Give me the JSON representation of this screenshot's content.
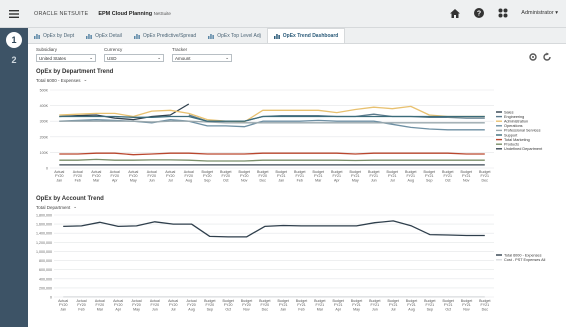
{
  "header": {
    "logo": "ORACLE NETSUITE",
    "app_title": "EPM Cloud Planning",
    "app_subtitle": "NetSuite",
    "user": "Administrator"
  },
  "sidebar": {
    "steps": [
      "1",
      "2"
    ]
  },
  "tabs": [
    {
      "label": "OpEx by Dept",
      "icon": "chart-icon"
    },
    {
      "label": "OpEx Detail",
      "icon": "chart-icon"
    },
    {
      "label": "OpEx Predictive/Spread",
      "icon": "chart-icon"
    },
    {
      "label": "OpEx Top Level Adj",
      "icon": "chart-icon"
    },
    {
      "label": "OpEx Trend Dashboard",
      "icon": "chart-icon",
      "active": true
    }
  ],
  "pov": {
    "subsidiary": {
      "label": "Subsidiary",
      "value": "United States"
    },
    "currency": {
      "label": "Currency",
      "value": "USD"
    },
    "tracker": {
      "label": "Tracker",
      "value": "Amount"
    }
  },
  "chart_data": [
    {
      "type": "line",
      "title": "OpEx by Department Trend",
      "selector": "Total 6000 - Expenses",
      "ylim": [
        0,
        500000
      ],
      "yticks": [
        "0",
        "100K",
        "200K",
        "300K",
        "400K",
        "500K"
      ],
      "x": [
        "Actual FY20 Jan",
        "Actual FY20 Feb",
        "Actual FY20 Mar",
        "Actual FY20 Apr",
        "Actual FY20 May",
        "Actual FY20 Jun",
        "Actual FY20 Jul",
        "Actual FY20 Aug",
        "Budget FY20 Sep",
        "Budget FY20 Oct",
        "Budget FY20 Nov",
        "Budget FY20 Dec",
        "Budget FY21 Jan",
        "Budget FY21 Feb",
        "Budget FY21 Mar",
        "Budget FY21 Apr",
        "Budget FY21 May",
        "Budget FY21 Jun",
        "Budget FY21 Jul",
        "Budget FY21 Aug",
        "Budget FY21 Sep",
        "Budget FY21 Oct",
        "Budget FY21 Nov",
        "Budget FY21 Dec"
      ],
      "series": [
        {
          "name": "Sales",
          "color": "#2f3f4c",
          "values": [
            330000,
            335000,
            340000,
            320000,
            310000,
            330000,
            340000,
            410000,
            null,
            null,
            null,
            null,
            null,
            null,
            null,
            null,
            null,
            null,
            null,
            null,
            null,
            null,
            null,
            null
          ]
        },
        {
          "name": "Engineering",
          "color": "#5b7a8c",
          "values": [
            null,
            null,
            null,
            null,
            null,
            null,
            null,
            340000,
            300000,
            300000,
            300000,
            330000,
            335000,
            335000,
            335000,
            330000,
            330000,
            345000,
            330000,
            330000,
            325000,
            325000,
            320000,
            320000
          ]
        },
        {
          "name": "Administration",
          "color": "#e8c170",
          "values": [
            340000,
            345000,
            350000,
            350000,
            330000,
            365000,
            370000,
            350000,
            310000,
            300000,
            295000,
            370000,
            370000,
            370000,
            370000,
            355000,
            375000,
            390000,
            380000,
            395000,
            340000,
            330000,
            330000,
            330000
          ]
        },
        {
          "name": "Operations",
          "color": "#6d8fa3",
          "values": [
            300000,
            305000,
            310000,
            305000,
            300000,
            290000,
            310000,
            300000,
            270000,
            270000,
            265000,
            300000,
            300000,
            300000,
            305000,
            300000,
            300000,
            300000,
            280000,
            260000,
            250000,
            245000,
            245000,
            245000
          ]
        },
        {
          "name": "Professional Services",
          "color": "#9aa8ad",
          "values": [
            300000,
            300000,
            300000,
            300000,
            300000,
            295000,
            300000,
            300000,
            295000,
            290000,
            290000,
            290000,
            290000,
            290000,
            290000,
            290000,
            290000,
            290000,
            290000,
            290000,
            290000,
            290000,
            290000,
            290000
          ]
        },
        {
          "name": "Support",
          "color": "#3b6b7a",
          "values": [
            330000,
            330000,
            330000,
            330000,
            325000,
            325000,
            330000,
            330000,
            300000,
            300000,
            300000,
            330000,
            330000,
            330000,
            330000,
            330000,
            330000,
            330000,
            330000,
            330000,
            330000,
            330000,
            330000,
            330000
          ]
        },
        {
          "name": "Total Marketing",
          "color": "#b9472f",
          "values": [
            90000,
            90000,
            95000,
            95000,
            85000,
            90000,
            95000,
            95000,
            90000,
            90000,
            90000,
            95000,
            95000,
            95000,
            95000,
            95000,
            90000,
            95000,
            95000,
            95000,
            95000,
            95000,
            90000,
            90000
          ]
        },
        {
          "name": "Products",
          "color": "#7a8f6a",
          "values": [
            50000,
            50000,
            55000,
            50000,
            50000,
            52000,
            52000,
            50000,
            45000,
            45000,
            45000,
            50000,
            50000,
            50000,
            50000,
            50000,
            48000,
            50000,
            50000,
            50000,
            50000,
            50000,
            50000,
            50000
          ]
        },
        {
          "name": "Undefined Department",
          "color": "#3d4a55",
          "values": [
            20000,
            20000,
            20000,
            20000,
            20000,
            20000,
            20000,
            20000,
            20000,
            20000,
            20000,
            20000,
            20000,
            20000,
            20000,
            20000,
            20000,
            20000,
            20000,
            20000,
            20000,
            20000,
            20000,
            20000
          ]
        }
      ]
    },
    {
      "type": "line",
      "title": "OpEx by Account Trend",
      "selector": "Total Department",
      "ylim": [
        0,
        1800000
      ],
      "yticks": [
        "0",
        "200,000",
        "400,000",
        "600,000",
        "800,000",
        "1,000,000",
        "1,200,000",
        "1,400,000",
        "1,600,000",
        "1,800,000"
      ],
      "x": [
        "Actual FY20 Jan",
        "Actual FY20 Feb",
        "Actual FY20 Mar",
        "Actual FY20 Apr",
        "Actual FY20 May",
        "Actual FY20 Jun",
        "Actual FY20 Jul",
        "Actual FY20 Aug",
        "Budget FY20 Sep",
        "Budget FY20 Oct",
        "Budget FY20 Nov",
        "Budget FY20 Dec",
        "Budget FY21 Jan",
        "Budget FY21 Feb",
        "Budget FY21 Mar",
        "Budget FY21 Apr",
        "Budget FY21 May",
        "Budget FY21 Jun",
        "Budget FY21 Jul",
        "Budget FY21 Aug",
        "Budget FY21 Sep",
        "Budget FY21 Oct",
        "Budget FY21 Nov",
        "Budget FY21 Dec"
      ],
      "series": [
        {
          "name": "Total 6000 - Expenses",
          "color": "#2f3f4c",
          "values": [
            1550000,
            1560000,
            1640000,
            1550000,
            1560000,
            1650000,
            1600000,
            1600000,
            1330000,
            1320000,
            1320000,
            1550000,
            1570000,
            1560000,
            1560000,
            1560000,
            1560000,
            1630000,
            1670000,
            1560000,
            1370000,
            1360000,
            1350000,
            1350000
          ]
        },
        {
          "name": "Cost - PST Expenses All",
          "color": "#d8dbde",
          "values": [
            1500,
            1500,
            1500,
            1500,
            1500,
            1500,
            1500,
            1500,
            1500,
            1500,
            1500,
            1500,
            1500,
            1500,
            1500,
            1500,
            1500,
            1500,
            1500,
            1500,
            1500,
            1500,
            1500,
            1500
          ]
        }
      ]
    }
  ]
}
